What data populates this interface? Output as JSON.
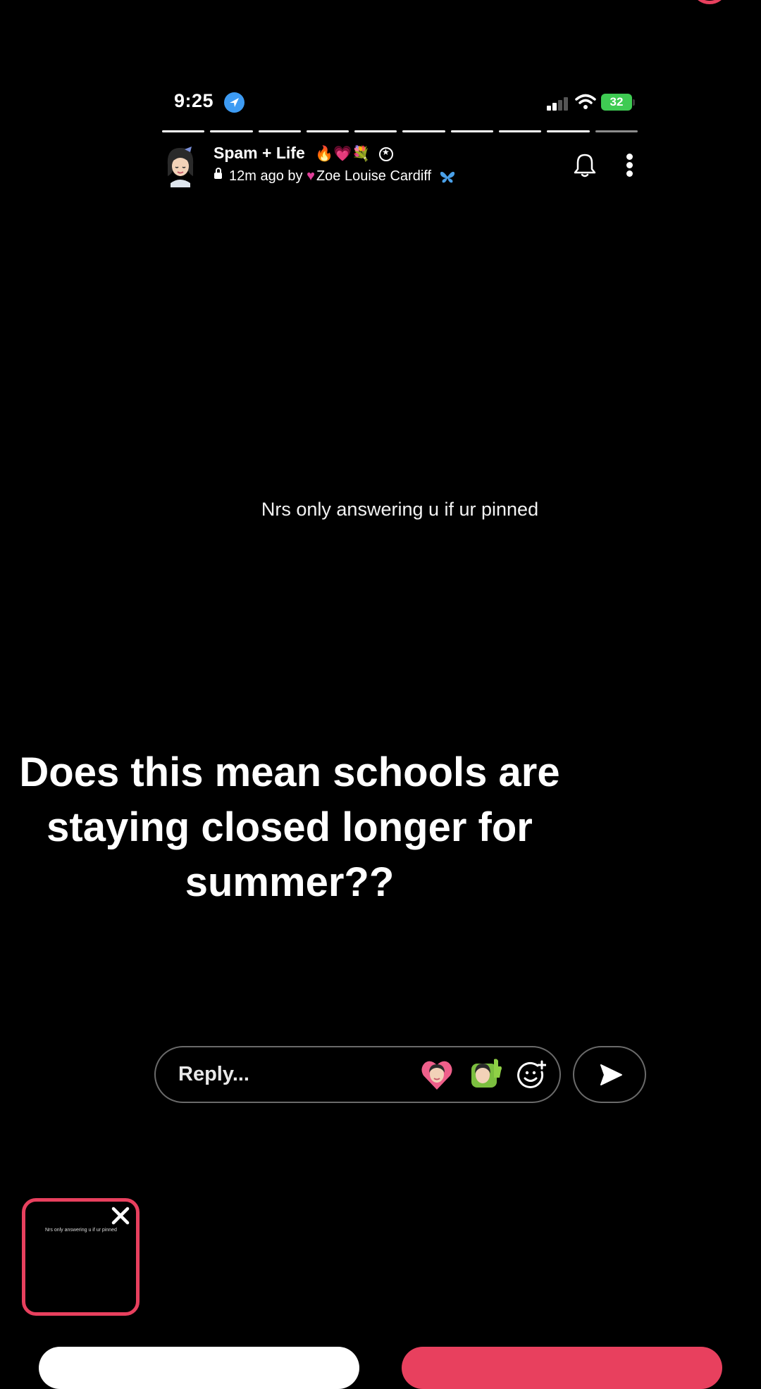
{
  "status_bar": {
    "time": "9:25",
    "battery": "32"
  },
  "story": {
    "title": "Spam + Life",
    "title_emojis": "🔥💗💐",
    "meta_prefix": "12m ago by",
    "author": "Zoe Louise Cardiff",
    "caption": "Nrs only answering u if ur pinned",
    "segments_total": 10,
    "segments_done": 9
  },
  "overlay": {
    "line1": "Does this mean schools are",
    "line2": "staying closed longer for",
    "line3": "summer??"
  },
  "reply": {
    "placeholder": "Reply..."
  },
  "thumbnail": {
    "text": "Nrs only answering u if ur pinned"
  },
  "colors": {
    "accent": "#e8405e",
    "location": "#3d9bf3",
    "battery": "#3fcb53"
  },
  "icons": {
    "location": "location-arrow-icon",
    "signal": "signal-icon",
    "wifi": "wifi-icon",
    "bell": "bell-icon",
    "more": "more-vertical-icon",
    "emoji_add": "emoji-add-icon",
    "send": "send-icon",
    "close": "close-icon"
  }
}
